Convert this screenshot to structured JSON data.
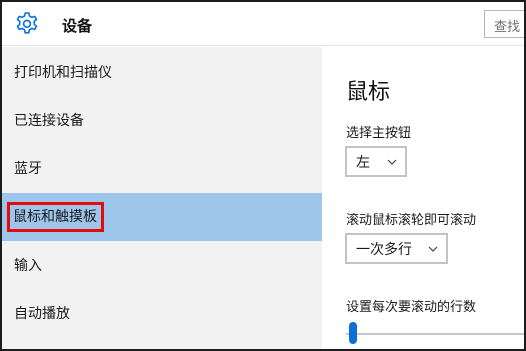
{
  "header": {
    "title": "设备",
    "search_placeholder": "查找"
  },
  "sidebar": {
    "items": [
      {
        "label": "打印机和扫描仪"
      },
      {
        "label": "已连接设备"
      },
      {
        "label": "蓝牙"
      },
      {
        "label": "鼠标和触摸板",
        "selected": true
      },
      {
        "label": "输入"
      },
      {
        "label": "自动播放"
      }
    ]
  },
  "main": {
    "title": "鼠标",
    "primary_button": {
      "label": "选择主按钮",
      "value": "左"
    },
    "scroll": {
      "label": "滚动鼠标滚轮即可滚动",
      "value": "一次多行"
    },
    "lines": {
      "label": "设置每次要滚动的行数"
    }
  },
  "colors": {
    "accent": "#0a6fd6",
    "selected_bg": "#9ec6ea",
    "highlight_box": "#e30c0c",
    "sidebar_bg": "#f2f2f2"
  }
}
